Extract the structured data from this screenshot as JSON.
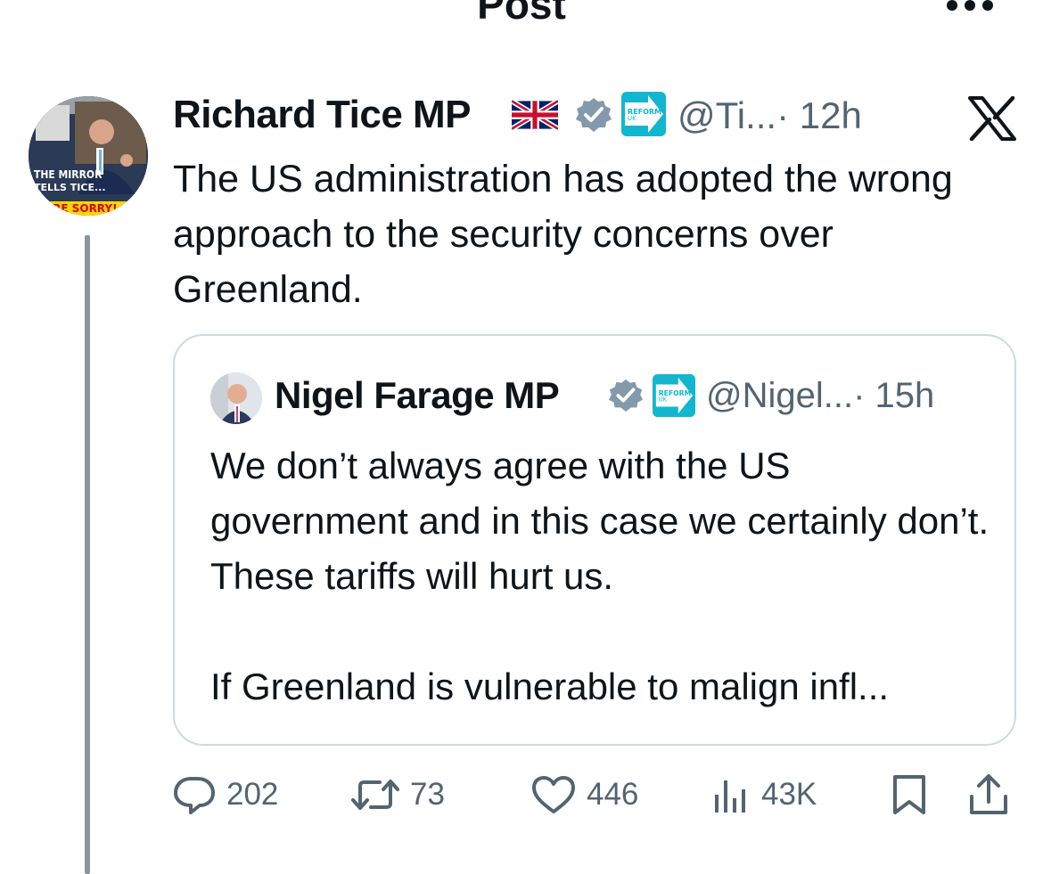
{
  "header": {
    "title": "Post"
  },
  "tweet": {
    "name": "Richard Tice MP",
    "handle": "@Ti...",
    "time": "· 12h",
    "text": "The US administration has adopted the wrong approach to the security concerns over Greenland.",
    "avatar_caption": {
      "line1": "THE MIRROR",
      "line2": "TELLS TICE...",
      "line3": "WE'RE SORRY!"
    },
    "reform_badge": {
      "line1": "REFORM",
      "line2": "UK"
    }
  },
  "quote": {
    "name": "Nigel Farage MP",
    "handle": "@Nigel...",
    "time": "· 15h",
    "text": "We don’t always agree with the US government and in this case we certainly don’t. These tariffs will hurt us.",
    "text2": "If Greenland is vulnerable to malign infl..."
  },
  "actions": {
    "replies": "202",
    "reposts": "73",
    "likes": "446",
    "views": "43K"
  },
  "colors": {
    "text": "#0f1419",
    "secondary": "#536471",
    "border": "#cfd9de",
    "verified": "#829aab",
    "reform": "#12b6cf"
  },
  "icons": [
    "back-arrow-icon",
    "more-icon",
    "uk-flag-icon",
    "verified-icon",
    "reform-uk-icon",
    "x-logo-icon",
    "reply-icon",
    "repost-icon",
    "like-icon",
    "views-icon",
    "bookmark-icon",
    "share-icon"
  ]
}
